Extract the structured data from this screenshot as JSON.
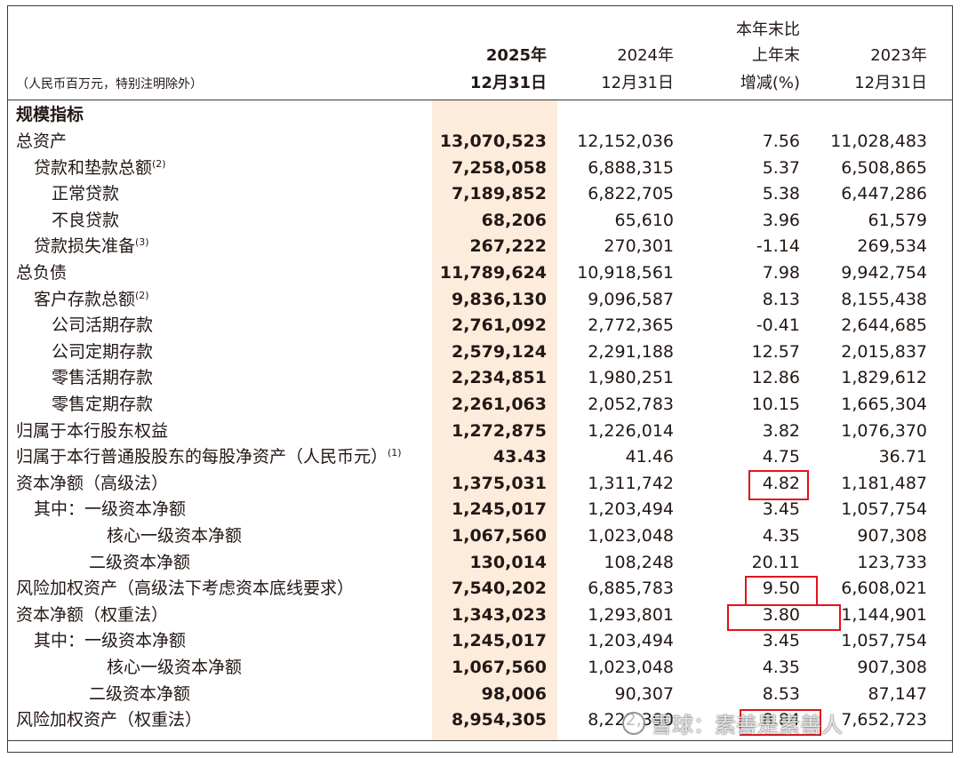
{
  "header": {
    "unit_note": "（人民币百万元，特别注明除外）",
    "col1": {
      "line1": "2025年",
      "line2": "12月31日"
    },
    "col2": {
      "line1": "2024年",
      "line2": "12月31日"
    },
    "col3": {
      "line1": "本年末比",
      "line2": "上年末",
      "line3": "增减(%)"
    },
    "col4": {
      "line1": "2023年",
      "line2": "12月31日"
    }
  },
  "section_title": "规模指标",
  "rows": [
    {
      "label": "总资产",
      "sup": "",
      "v2025": "13,070,523",
      "v2024": "12,152,036",
      "change": "7.56",
      "v2023": "11,028,483"
    },
    {
      "label": "贷款和垫款总额",
      "sup": "(2)",
      "v2025": "7,258,058",
      "v2024": "6,888,315",
      "change": "5.37",
      "v2023": "6,508,865"
    },
    {
      "label": "正常贷款",
      "sup": "",
      "v2025": "7,189,852",
      "v2024": "6,822,705",
      "change": "5.38",
      "v2023": "6,447,286"
    },
    {
      "label": "不良贷款",
      "sup": "",
      "v2025": "68,206",
      "v2024": "65,610",
      "change": "3.96",
      "v2023": "61,579"
    },
    {
      "label": "贷款损失准备",
      "sup": "(3)",
      "v2025": "267,222",
      "v2024": "270,301",
      "change": "-1.14",
      "v2023": "269,534"
    },
    {
      "label": "总负债",
      "sup": "",
      "v2025": "11,789,624",
      "v2024": "10,918,561",
      "change": "7.98",
      "v2023": "9,942,754"
    },
    {
      "label": "客户存款总额",
      "sup": "(2)",
      "v2025": "9,836,130",
      "v2024": "9,096,587",
      "change": "8.13",
      "v2023": "8,155,438"
    },
    {
      "label": "公司活期存款",
      "sup": "",
      "v2025": "2,761,092",
      "v2024": "2,772,365",
      "change": "-0.41",
      "v2023": "2,644,685"
    },
    {
      "label": "公司定期存款",
      "sup": "",
      "v2025": "2,579,124",
      "v2024": "2,291,188",
      "change": "12.57",
      "v2023": "2,015,837"
    },
    {
      "label": "零售活期存款",
      "sup": "",
      "v2025": "2,234,851",
      "v2024": "1,980,251",
      "change": "12.86",
      "v2023": "1,829,612"
    },
    {
      "label": "零售定期存款",
      "sup": "",
      "v2025": "2,261,063",
      "v2024": "2,052,783",
      "change": "10.15",
      "v2023": "1,665,304"
    },
    {
      "label": "归属于本行股东权益",
      "sup": "",
      "v2025": "1,272,875",
      "v2024": "1,226,014",
      "change": "3.82",
      "v2023": "1,076,370"
    },
    {
      "label": "归属于本行普通股股东的每股净资产（人民币元）",
      "sup": "(1)",
      "v2025": "43.43",
      "v2024": "41.46",
      "change": "4.75",
      "v2023": "36.71"
    },
    {
      "label": "资本净额（高级法）",
      "sup": "",
      "v2025": "1,375,031",
      "v2024": "1,311,742",
      "change": "4.82",
      "v2023": "1,181,487"
    },
    {
      "label": "其中：一级资本净额",
      "sup": "",
      "v2025": "1,245,017",
      "v2024": "1,203,494",
      "change": "3.45",
      "v2023": "1,057,754"
    },
    {
      "label": "核心一级资本净额",
      "sup": "",
      "v2025": "1,067,560",
      "v2024": "1,023,048",
      "change": "4.35",
      "v2023": "907,308"
    },
    {
      "label": "二级资本净额",
      "sup": "",
      "v2025": "130,014",
      "v2024": "108,248",
      "change": "20.11",
      "v2023": "123,733"
    },
    {
      "label": "风险加权资产（高级法下考虑资本底线要求）",
      "sup": "",
      "v2025": "7,540,202",
      "v2024": "6,885,783",
      "change": "9.50",
      "v2023": "6,608,021"
    },
    {
      "label": "资本净额（权重法）",
      "sup": "",
      "v2025": "1,343,023",
      "v2024": "1,293,801",
      "change": "3.80",
      "v2023": "1,144,901"
    },
    {
      "label": "其中：一级资本净额",
      "sup": "",
      "v2025": "1,245,017",
      "v2024": "1,203,494",
      "change": "3.45",
      "v2023": "1,057,754"
    },
    {
      "label": "核心一级资本净额",
      "sup": "",
      "v2025": "1,067,560",
      "v2024": "1,023,048",
      "change": "4.35",
      "v2023": "907,308"
    },
    {
      "label": "二级资本净额",
      "sup": "",
      "v2025": "98,006",
      "v2024": "90,307",
      "change": "8.53",
      "v2023": "87,147"
    },
    {
      "label": "风险加权资产（权重法）",
      "sup": "",
      "v2025": "8,954,305",
      "v2024": "8,222,390",
      "change": "8.84",
      "v2023": "7,652,723"
    }
  ],
  "annotation_color": "#e1141e",
  "highlight_color": "#fdecdc",
  "watermark": {
    "text": "雪球：素善是素善人"
  }
}
